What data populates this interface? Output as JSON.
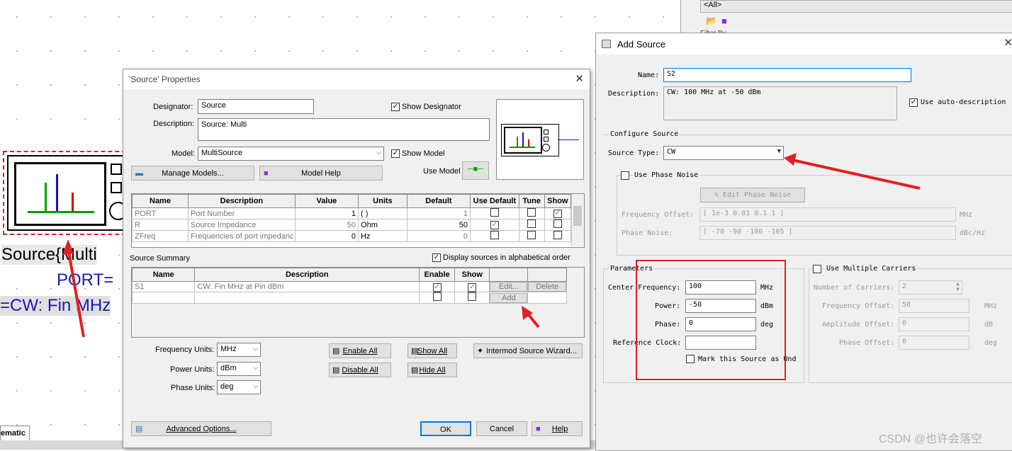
{
  "canvas": {
    "component_label": "Source{Multi",
    "port_label": "PORT=",
    "cw_label": "=CW: Fin MHz",
    "tab_label": "ematic",
    "filter_label": "<All>",
    "filter_by_label": "Filter By"
  },
  "props": {
    "title": "'Source' Properties",
    "designator_label": "Designator:",
    "designator_value": "Source",
    "show_designator": "Show Designator",
    "description_label": "Description:",
    "description_value": "Source: Multi",
    "model_label": "Model:",
    "model_value": "MultiSource",
    "show_model": "Show Model",
    "manage_models": "Manage Models...",
    "model_help": "Model Help",
    "use_model": "Use Model",
    "param_headers": [
      "Name",
      "Description",
      "Value",
      "Units",
      "Default",
      "Use Default",
      "Tune",
      "Show"
    ],
    "param_rows": [
      {
        "name": "PORT",
        "desc": "Port Number",
        "value": "1",
        "units": "( )",
        "default": "1"
      },
      {
        "name": "R",
        "desc": "Source Impedance",
        "value": "50",
        "units": "Ohm",
        "default": "50"
      },
      {
        "name": "ZFreq",
        "desc": "Frequencies of port impedanc",
        "value": "0",
        "units": "Hz",
        "default": "0"
      }
    ],
    "source_summary": "Source Summary",
    "display_alpha": "Display sources in alphabetical order",
    "summary_headers": [
      "Name",
      "Description",
      "Enable",
      "Show"
    ],
    "summary_rows": [
      {
        "name": "S1",
        "desc": "CW: Fin MHz at Pin dBm"
      }
    ],
    "edit_btn": "Edit...",
    "delete_btn": "Delete",
    "add_btn": "Add",
    "freq_units_label": "Frequency Units:",
    "freq_units": "MHz",
    "power_units_label": "Power Units:",
    "power_units": "dBm",
    "phase_units_label": "Phase Units:",
    "phase_units": "deg",
    "enable_all": "Enable All",
    "disable_all": "Disable All",
    "show_all": "Show All",
    "hide_all": "Hide All",
    "intermod_wizard": "Intermod Source Wizard...",
    "advanced_options": "Advanced Options...",
    "ok": "OK",
    "cancel": "Cancel",
    "help": "Help"
  },
  "add": {
    "title": "Add Source",
    "name_label": "Name:",
    "name_value": "S2",
    "description_label": "Description:",
    "description_value": "CW: 100 MHz at -50 dBm",
    "use_auto": "Use auto-description",
    "configure_source": "Configure Source",
    "source_type_label": "Source Type:",
    "source_type": "CW",
    "use_phase_noise": "Use Phase Noise",
    "edit_phase_noise": "Edit Phase Noise",
    "freq_offset_label": "Frequency Offset:",
    "freq_offset_value": "[ 1e-3 0.01 0.1 1 ]",
    "freq_offset_unit": "MHz",
    "phase_noise_label": "Phase Noise:",
    "phase_noise_value": "[ -70 -90 -100 -105 ]",
    "phase_noise_unit": "dBc/Hz",
    "parameters": "Parameters",
    "center_freq_label": "Center Frequency:",
    "center_freq_value": "100",
    "center_freq_unit": "MHz",
    "power_label": "Power:",
    "power_value": "-50",
    "power_unit": "dBm",
    "phase_label": "Phase:",
    "phase_value": "0",
    "phase_unit": "deg",
    "ref_clock_label": "Reference Clock:",
    "ref_clock_value": "",
    "mark_source": "Mark this Source as Und",
    "use_multiple": "Use Multiple Carriers",
    "num_carriers_label": "Number of Carriers:",
    "num_carriers_value": "2",
    "freq_offset2_label": "Frequency Offset:",
    "freq_offset2_value": "50",
    "freq_offset2_unit": "MHz",
    "amp_offset_label": "Amplitude Offset:",
    "amp_offset_value": "0",
    "amp_offset_unit": "dB",
    "phase_offset_label": "Phase Offset:",
    "phase_offset_value": "0",
    "phase_offset_unit": "deg"
  },
  "watermark": "CSDN @也许会落空",
  "colors": {
    "accent": "#0078d7",
    "red_annotation": "#e02020",
    "schematic_blue": "#1a1ab0"
  }
}
